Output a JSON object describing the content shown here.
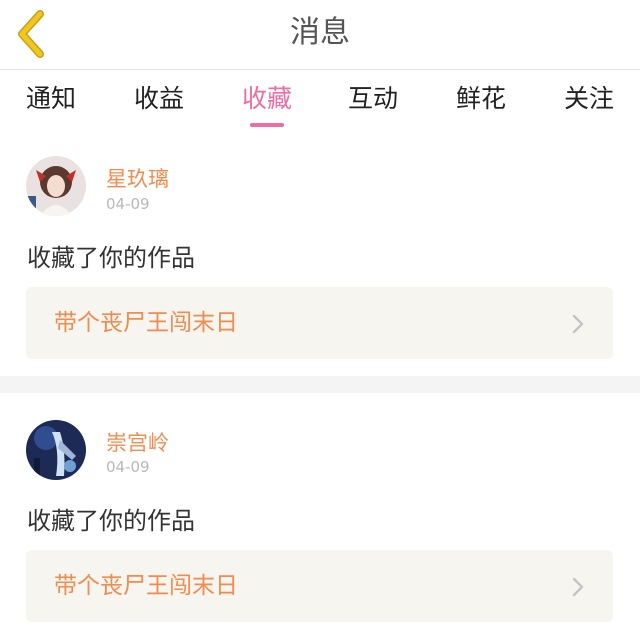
{
  "header": {
    "title": "消息",
    "back_icon": "chevron-left-icon"
  },
  "tabs": [
    {
      "label": "通知",
      "active": false
    },
    {
      "label": "收益",
      "active": false
    },
    {
      "label": "收藏",
      "active": true
    },
    {
      "label": "互动",
      "active": false
    },
    {
      "label": "鲜花",
      "active": false
    },
    {
      "label": "关注",
      "active": false
    }
  ],
  "notifications": [
    {
      "username": "星玖璃",
      "date": "04-09",
      "action": "收藏了你的作品",
      "work_title": "带个丧尸王闯末日"
    },
    {
      "username": "崇宫岭",
      "date": "04-09",
      "action": "收藏了你的作品",
      "work_title": "带个丧尸王闯末日"
    }
  ],
  "colors": {
    "accent_pink": "#ec6ea4",
    "accent_orange": "#f08c4e",
    "back_icon_yellow": "#f2c61f"
  }
}
